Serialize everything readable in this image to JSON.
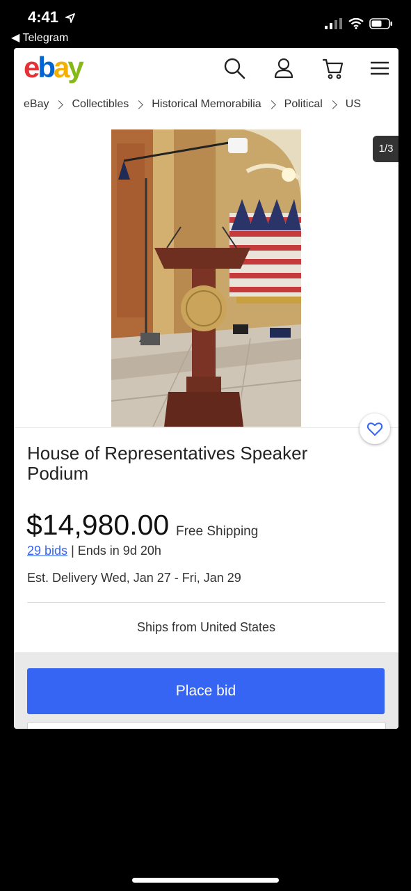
{
  "status_bar": {
    "time": "4:41",
    "back_label": "Telegram"
  },
  "header": {
    "logo_letters": [
      "e",
      "b",
      "a",
      "y"
    ],
    "logo_colors": [
      "#e53238",
      "#0064d2",
      "#f5af02",
      "#86b817"
    ],
    "icons": [
      "search-icon",
      "account-icon",
      "cart-icon",
      "menu-icon"
    ]
  },
  "breadcrumb": [
    "eBay",
    "Collectibles",
    "Historical Memorabilia",
    "Political",
    "US"
  ],
  "gallery": {
    "counter": "1/3"
  },
  "listing": {
    "title": "House of Representatives Speaker Podium",
    "price": "$14,980.00",
    "shipping": "Free Shipping",
    "bids": "29 bids",
    "separator": "|",
    "ends": "Ends in 9d 20h",
    "delivery": "Est. Delivery Wed, Jan 27 - Fri, Jan 29",
    "ships_from": "Ships from United States"
  },
  "actions": {
    "place_bid": "Place bid"
  },
  "colors": {
    "accent": "#3665f3",
    "background": "#000000"
  }
}
